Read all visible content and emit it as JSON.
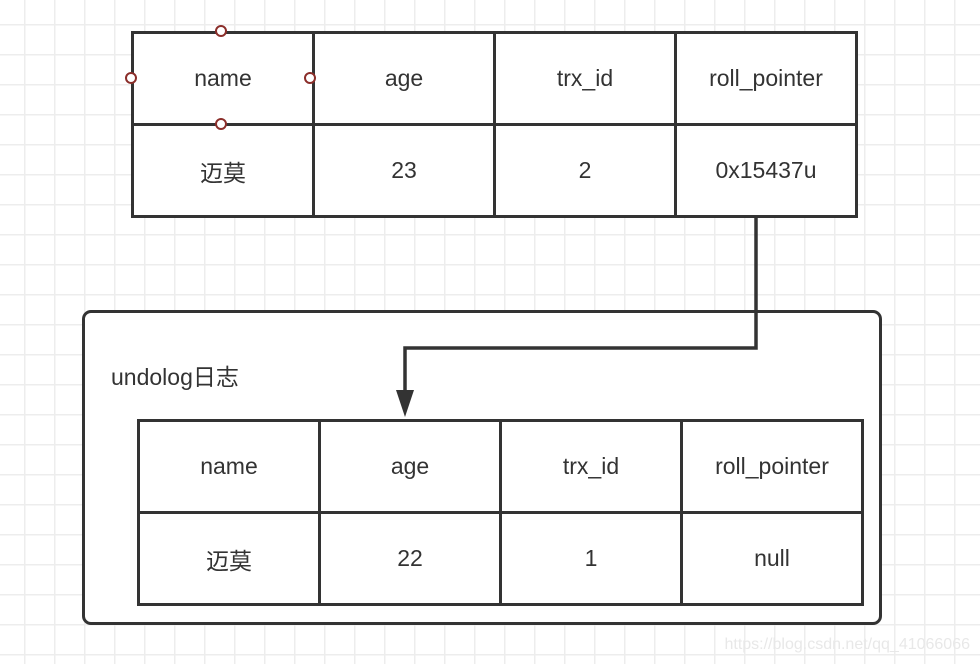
{
  "current_record": {
    "headers": [
      "name",
      "age",
      "trx_id",
      "roll_pointer"
    ],
    "values": [
      "迈莫",
      "23",
      "2",
      "0x15437u"
    ]
  },
  "undolog": {
    "title": "undolog日志",
    "headers": [
      "name",
      "age",
      "trx_id",
      "roll_pointer"
    ],
    "values": [
      "迈莫",
      "22",
      "1",
      "null"
    ]
  },
  "connector": {
    "from": "current_record.roll_pointer",
    "to": "undolog.record",
    "icon": "arrow-down-icon"
  },
  "selection_handles": [
    "top",
    "left",
    "right",
    "bottom"
  ],
  "watermark": "https://blog.csdn.net/qq_41066066",
  "colors": {
    "stroke": "#333333",
    "handle": "#8b2e2a",
    "grid": "#ededed"
  }
}
